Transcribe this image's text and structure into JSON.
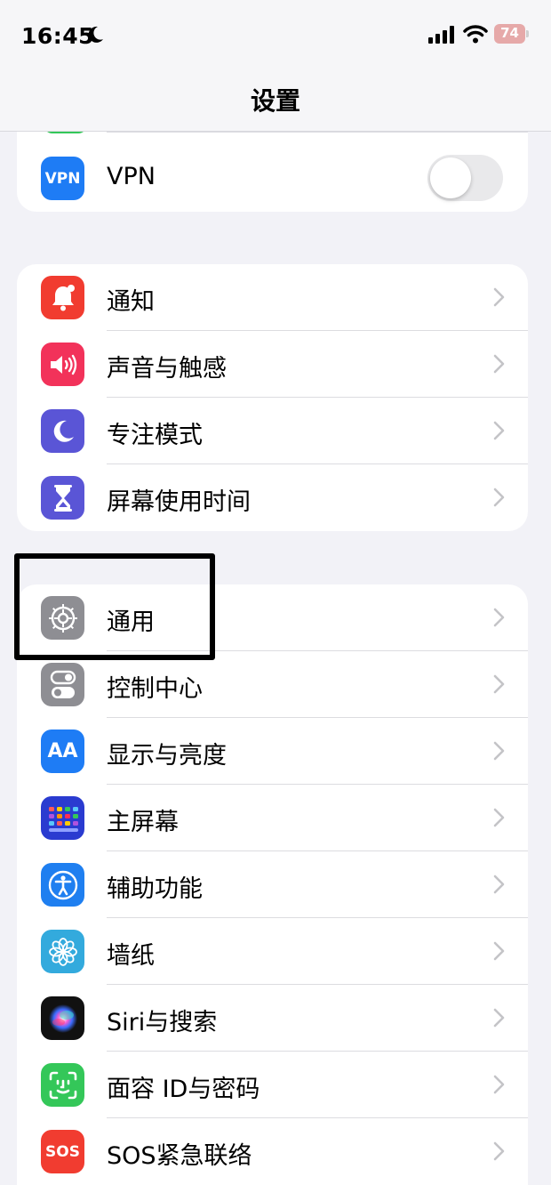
{
  "status_bar": {
    "time": "16:45",
    "battery": "74"
  },
  "nav": {
    "title": "设置"
  },
  "vpn": {
    "label": "VPN",
    "icon_text": "VPN",
    "toggle_on": false
  },
  "group1": [
    {
      "label": "通知",
      "icon": "bell-icon",
      "color": "#f13c30"
    },
    {
      "label": "声音与触感",
      "icon": "speaker-icon",
      "color": "#f2325a"
    },
    {
      "label": "专注模式",
      "icon": "moon-icon",
      "color": "#5a55d6"
    },
    {
      "label": "屏幕使用时间",
      "icon": "hourglass-icon",
      "color": "#5a55d6"
    }
  ],
  "group2": [
    {
      "label": "通用",
      "icon": "gear-icon",
      "color": "#8e8e93"
    },
    {
      "label": "控制中心",
      "icon": "switches-icon",
      "color": "#8e8e93"
    },
    {
      "label": "显示与亮度",
      "icon": "text-size-icon",
      "icon_text": "AA",
      "color": "#1e7cf5"
    },
    {
      "label": "主屏幕",
      "icon": "app-grid-icon",
      "color": "#2a3bd0"
    },
    {
      "label": "辅助功能",
      "icon": "accessibility-icon",
      "color": "#1f7ff0"
    },
    {
      "label": "墙纸",
      "icon": "flower-icon",
      "color": "#33aadd"
    },
    {
      "label": "Siri与搜索",
      "icon": "siri-icon",
      "color": "#111111"
    },
    {
      "label": "面容 ID与密码",
      "icon": "face-id-icon",
      "color": "#34c759"
    },
    {
      "label": "SOS紧急联络",
      "icon": "sos-icon",
      "icon_text": "SOS",
      "color": "#f13c30"
    }
  ]
}
